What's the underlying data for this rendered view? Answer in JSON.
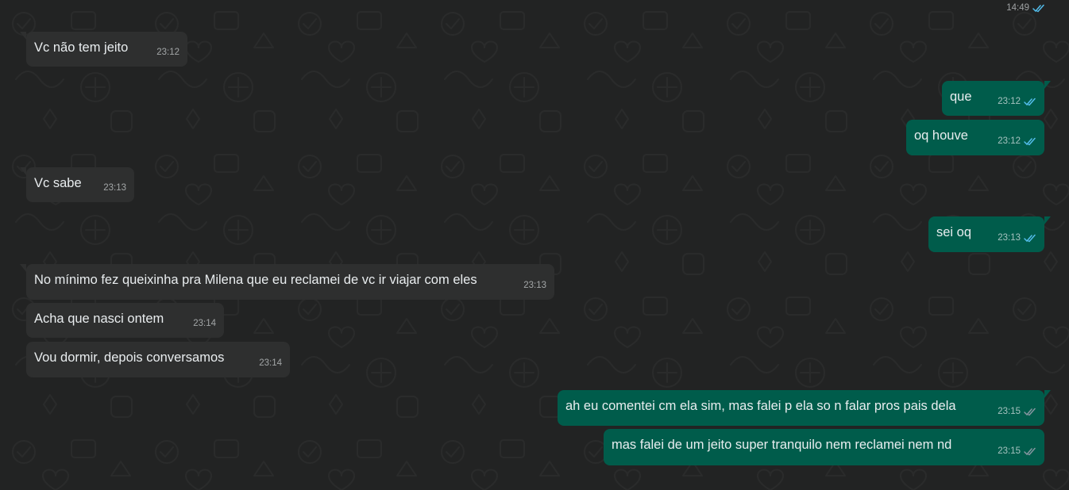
{
  "top_message": {
    "time": "14:49",
    "status": "read"
  },
  "messages": [
    {
      "text": "Vc não tem jeito",
      "time": "23:12",
      "direction": "incoming"
    },
    {
      "text": "que",
      "time": "23:12",
      "direction": "outgoing",
      "status": "read"
    },
    {
      "text": "oq houve",
      "time": "23:12",
      "direction": "outgoing",
      "status": "read"
    },
    {
      "text": "Vc sabe",
      "time": "23:13",
      "direction": "incoming"
    },
    {
      "text": "sei oq",
      "time": "23:13",
      "direction": "outgoing",
      "status": "read"
    },
    {
      "text": "No mínimo fez queixinha pra Milena que eu reclamei de vc ir viajar com eles",
      "time": "23:13",
      "direction": "incoming"
    },
    {
      "text": "Acha que nasci ontem",
      "time": "23:14",
      "direction": "incoming"
    },
    {
      "text": "Vou dormir, depois conversamos",
      "time": "23:14",
      "direction": "incoming"
    },
    {
      "text": "ah eu comentei cm ela sim, mas falei p ela so n falar pros pais dela",
      "time": "23:15",
      "direction": "outgoing",
      "status": "delivered"
    },
    {
      "text": "mas falei de um jeito super tranquilo nem reclamei nem nd",
      "time": "23:15",
      "direction": "outgoing",
      "status": "delivered"
    }
  ],
  "colors": {
    "background": "#222323",
    "incoming_bubble": "#2e2f2f",
    "outgoing_bubble": "#005c4b",
    "read_check": "#53bdeb",
    "delivered_check": "#8696a0"
  },
  "icons": {
    "read": "double-check-icon",
    "delivered": "double-check-icon"
  }
}
